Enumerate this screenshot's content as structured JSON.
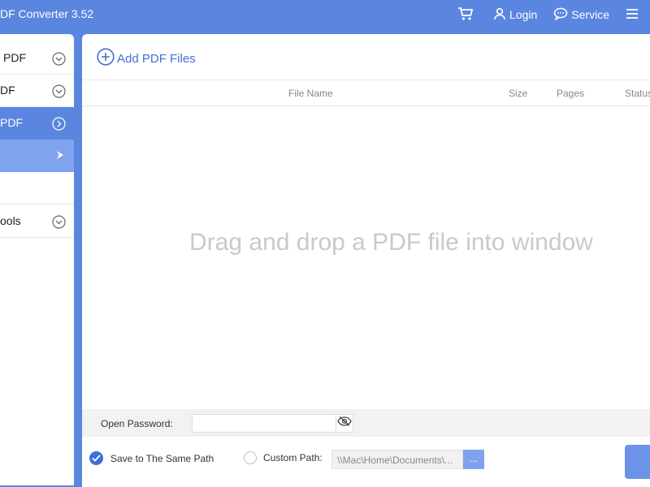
{
  "app": {
    "title": "DF Converter 3.52"
  },
  "header": {
    "login": "Login",
    "service": "Service"
  },
  "sidebar": {
    "items": [
      {
        "label": "PDF"
      },
      {
        "label": "DF"
      },
      {
        "label": "PDF"
      },
      {
        "label": ""
      },
      {
        "label": ""
      },
      {
        "label": "ools"
      }
    ]
  },
  "main": {
    "add_files": "Add PDF Files",
    "columns": {
      "file_name": "File Name",
      "size": "Size",
      "pages": "Pages",
      "status": "Status"
    },
    "drop_message": "Drag and drop a PDF file into window",
    "open_password_label": "Open Password:",
    "save_same_path": "Save to The Same Path",
    "custom_path_label": "Custom Path:",
    "custom_path_value": "\\\\Mac\\Home\\Documents\\...",
    "browse": "..."
  },
  "colors": {
    "accent": "#5b86e0",
    "link": "#3f6fd6"
  }
}
